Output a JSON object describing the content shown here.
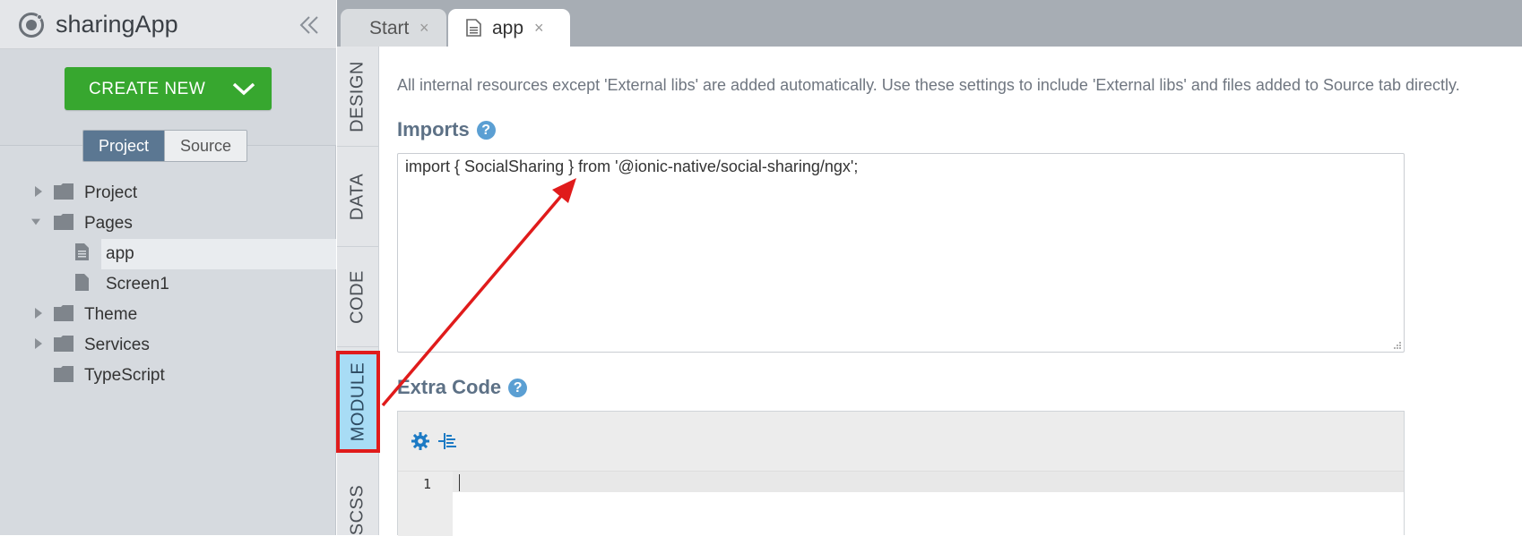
{
  "app": {
    "title": "sharingApp"
  },
  "sidebar": {
    "create_button": "CREATE NEW",
    "toggle": {
      "project": "Project",
      "source": "Source"
    },
    "tree": [
      {
        "label": "Project",
        "type": "folder",
        "expanded": false
      },
      {
        "label": "Pages",
        "type": "folder",
        "expanded": true
      },
      {
        "label": "app",
        "type": "page",
        "selected": true
      },
      {
        "label": "Screen1",
        "type": "page"
      },
      {
        "label": "Theme",
        "type": "folder",
        "expanded": false
      },
      {
        "label": "Services",
        "type": "folder",
        "expanded": false
      },
      {
        "label": "TypeScript",
        "type": "folder"
      }
    ]
  },
  "tabs": [
    {
      "label": "Start",
      "close": "×"
    },
    {
      "label": "app",
      "close": "×",
      "active": true
    }
  ],
  "vertical_tabs": [
    "DESIGN",
    "DATA",
    "CODE",
    "MODULE",
    "SCSS"
  ],
  "active_vertical_tab": "MODULE",
  "content": {
    "hint": "All internal resources except 'External libs' are added automatically. Use these settings to include 'External libs' and files added to Source tab directly.",
    "imports": {
      "title": "Imports",
      "help": "?",
      "value": "import { SocialSharing } from '@ionic-native/social-sharing/ngx';"
    },
    "extra_code": {
      "title": "Extra Code",
      "help": "?",
      "line_number": "1"
    }
  },
  "colors": {
    "create_button": "#37a72f",
    "toggle_active": "#5b7792",
    "tab_bar": "#a7adb4",
    "active_vtab_fill": "#a8dcf5",
    "annotation_red": "#e01b1b",
    "section_title": "#5d7186",
    "help_icon": "#5b9fd3"
  },
  "icons": {
    "logo": "ionic-logo-icon",
    "collapse": "double-chevron-left-icon",
    "create_dropdown": "chevron-down-icon",
    "folder": "folder-icon",
    "page": "file-icon",
    "settings": "gear-icon",
    "format": "indent-icon"
  }
}
